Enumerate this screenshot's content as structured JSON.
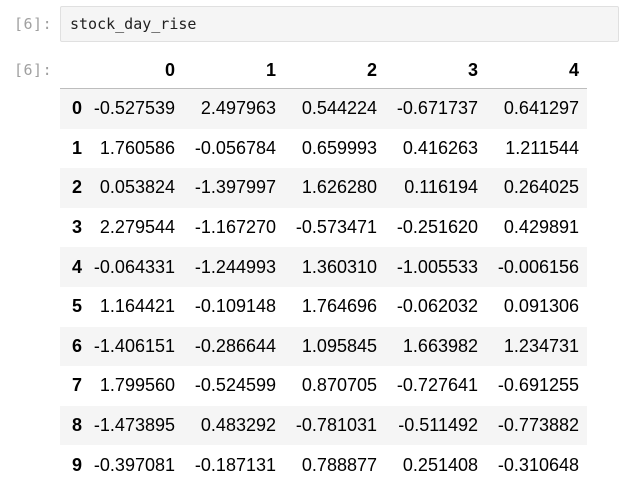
{
  "input_cell": {
    "prompt": "[6]:",
    "code": "stock_day_rise"
  },
  "output_cell": {
    "prompt": "[6]:",
    "table": {
      "columns": [
        "0",
        "1",
        "2",
        "3",
        "4"
      ],
      "rows": [
        {
          "index": "0",
          "values": [
            "-0.527539",
            "2.497963",
            "0.544224",
            "-0.671737",
            "0.641297"
          ]
        },
        {
          "index": "1",
          "values": [
            "1.760586",
            "-0.056784",
            "0.659993",
            "0.416263",
            "1.211544"
          ]
        },
        {
          "index": "2",
          "values": [
            "0.053824",
            "-1.397997",
            "1.626280",
            "0.116194",
            "0.264025"
          ]
        },
        {
          "index": "3",
          "values": [
            "2.279544",
            "-1.167270",
            "-0.573471",
            "-0.251620",
            "0.429891"
          ]
        },
        {
          "index": "4",
          "values": [
            "-0.064331",
            "-1.244993",
            "1.360310",
            "-1.005533",
            "-0.006156"
          ]
        },
        {
          "index": "5",
          "values": [
            "1.164421",
            "-0.109148",
            "1.764696",
            "-0.062032",
            "0.091306"
          ]
        },
        {
          "index": "6",
          "values": [
            "-1.406151",
            "-0.286644",
            "1.095845",
            "1.663982",
            "1.234731"
          ]
        },
        {
          "index": "7",
          "values": [
            "1.799560",
            "-0.524599",
            "0.870705",
            "-0.727641",
            "-0.691255"
          ]
        },
        {
          "index": "8",
          "values": [
            "-1.473895",
            "0.483292",
            "-0.781031",
            "-0.511492",
            "-0.773882"
          ]
        },
        {
          "index": "9",
          "values": [
            "-0.397081",
            "-0.187131",
            "0.788877",
            "0.251408",
            "-0.310648"
          ]
        }
      ]
    }
  }
}
